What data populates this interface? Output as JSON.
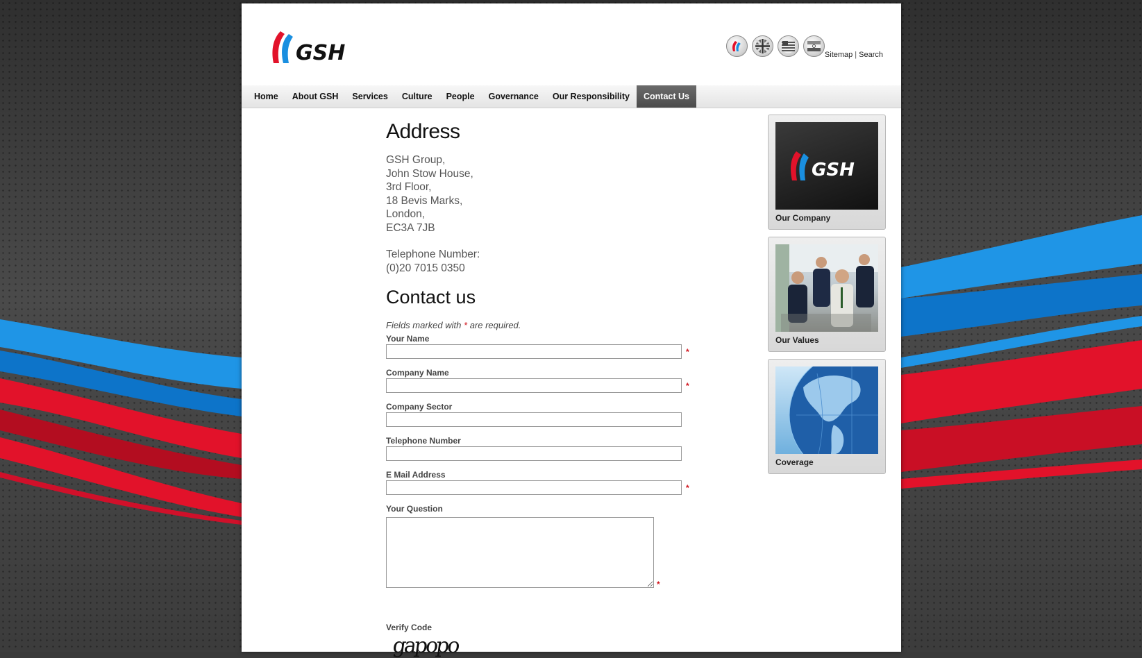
{
  "site": {
    "logo_text": "GSH"
  },
  "header": {
    "flags": [
      {
        "name": "gsh-home",
        "icon": "gsh-flag-icon"
      },
      {
        "name": "uk",
        "icon": "uk-flag-icon"
      },
      {
        "name": "usa",
        "icon": "us-flag-icon"
      },
      {
        "name": "india",
        "icon": "india-flag-icon"
      }
    ],
    "sitemap_label": "Sitemap",
    "separator": "|",
    "search_label": "Search"
  },
  "nav": {
    "items": [
      "Home",
      "About GSH",
      "Services",
      "Culture",
      "People",
      "Governance",
      "Our Responsibility",
      "Contact Us"
    ],
    "active": "Contact Us"
  },
  "address": {
    "title": "Address",
    "lines": [
      "GSH Group,",
      "John Stow House,",
      "3rd Floor,",
      "18 Bevis Marks,",
      "London,",
      "EC3A 7JB"
    ],
    "phone_label": "Telephone Number:",
    "phone": "(0)20 7015 0350"
  },
  "contact_form": {
    "title": "Contact us",
    "note_prefix": "Fields marked with",
    "note_star": "*",
    "note_suffix": "are required.",
    "fields": [
      {
        "label": "Your Name",
        "value": "",
        "required": true
      },
      {
        "label": "Company Name",
        "value": "",
        "required": true
      },
      {
        "label": "Company Sector",
        "value": "",
        "required": false
      },
      {
        "label": "Telephone Number",
        "value": "",
        "required": false
      },
      {
        "label": "E Mail Address",
        "value": "",
        "required": true
      }
    ],
    "question_label": "Your Question",
    "question_value": "",
    "question_required": true,
    "required_mark": "*",
    "verify_label": "Verify Code",
    "captcha_text": "gapopo"
  },
  "sidebar": {
    "cards": [
      {
        "caption": "Our Company",
        "image": "gsh-logo-image"
      },
      {
        "caption": "Our Values",
        "image": "team-photo-image"
      },
      {
        "caption": "Coverage",
        "image": "globe-image"
      }
    ]
  },
  "colors": {
    "brand_red": "#e2122a",
    "brand_blue": "#1a8fe0",
    "nav_active_bg": "#555555",
    "required_red": "#d0131b"
  }
}
